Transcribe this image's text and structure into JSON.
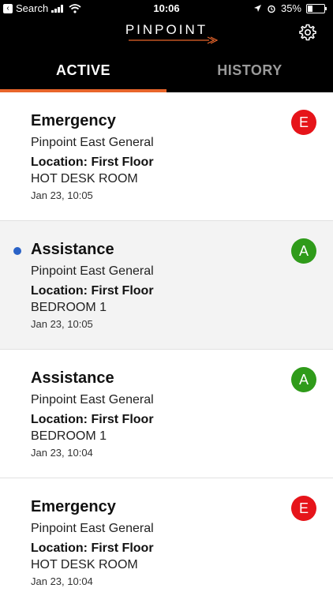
{
  "status_bar": {
    "back_label": "Search",
    "time": "10:06",
    "battery": "35%",
    "battery_level": 0.35
  },
  "header": {
    "logo_text": "PINPOINT",
    "accent_color": "#e8652b"
  },
  "tabs": [
    {
      "label": "ACTIVE",
      "active": true
    },
    {
      "label": "HISTORY",
      "active": false
    }
  ],
  "alerts": [
    {
      "title": "Emergency",
      "facility": "Pinpoint East General",
      "location": "Location: First Floor",
      "room": "HOT DESK ROOM",
      "time": "Jan 23, 10:05",
      "badge": "E",
      "badge_color": "#e6141a",
      "unread": false
    },
    {
      "title": "Assistance",
      "facility": "Pinpoint East General",
      "location": "Location: First Floor",
      "room": "BEDROOM 1",
      "time": "Jan 23, 10:05",
      "badge": "A",
      "badge_color": "#2f9b1a",
      "unread": true
    },
    {
      "title": "Assistance",
      "facility": "Pinpoint East General",
      "location": "Location: First Floor",
      "room": "BEDROOM 1",
      "time": "Jan 23, 10:04",
      "badge": "A",
      "badge_color": "#2f9b1a",
      "unread": false
    },
    {
      "title": "Emergency",
      "facility": "Pinpoint East General",
      "location": "Location: First Floor",
      "room": "HOT DESK ROOM",
      "time": "Jan 23, 10:04",
      "badge": "E",
      "badge_color": "#e6141a",
      "unread": false
    }
  ]
}
